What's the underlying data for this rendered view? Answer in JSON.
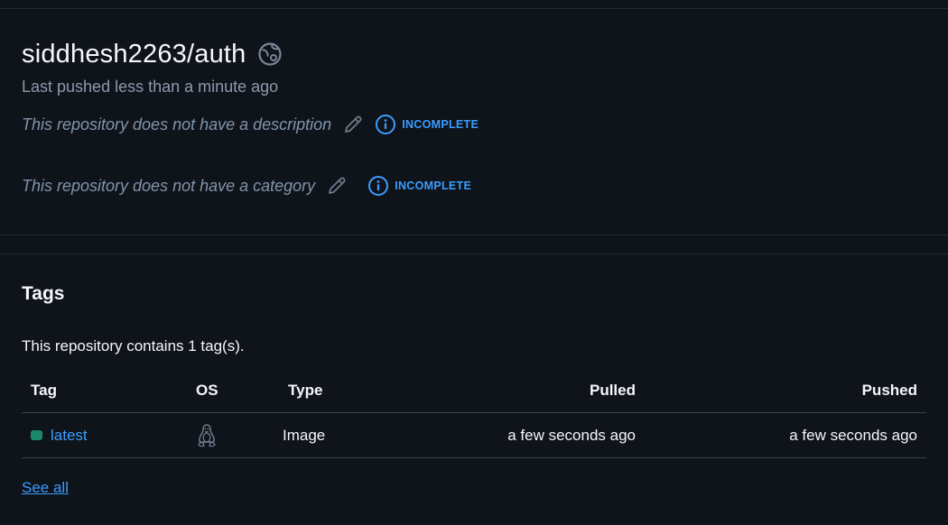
{
  "repository": {
    "name": "siddhesh2263/auth",
    "visibility_icon": "globe-icon",
    "last_pushed": "Last pushed less than a minute ago",
    "description_placeholder": "This repository does not have a description",
    "category_placeholder": "This repository does not have a category",
    "description_status": "INCOMPLETE",
    "category_status": "INCOMPLETE"
  },
  "tags": {
    "title": "Tags",
    "count_text": "This repository contains 1 tag(s).",
    "columns": [
      "Tag",
      "OS",
      "Type",
      "Pulled",
      "Pushed"
    ],
    "rows": [
      {
        "tag": "latest",
        "os_icon": "linux-icon",
        "type": "Image",
        "pulled": "a few seconds ago",
        "pushed": "a few seconds ago",
        "status_color": "#1c8a6a"
      }
    ],
    "see_all": "See all"
  },
  "colors": {
    "background": "#0f131a",
    "accent": "#3b9dff",
    "muted_text": "#8294ab"
  }
}
